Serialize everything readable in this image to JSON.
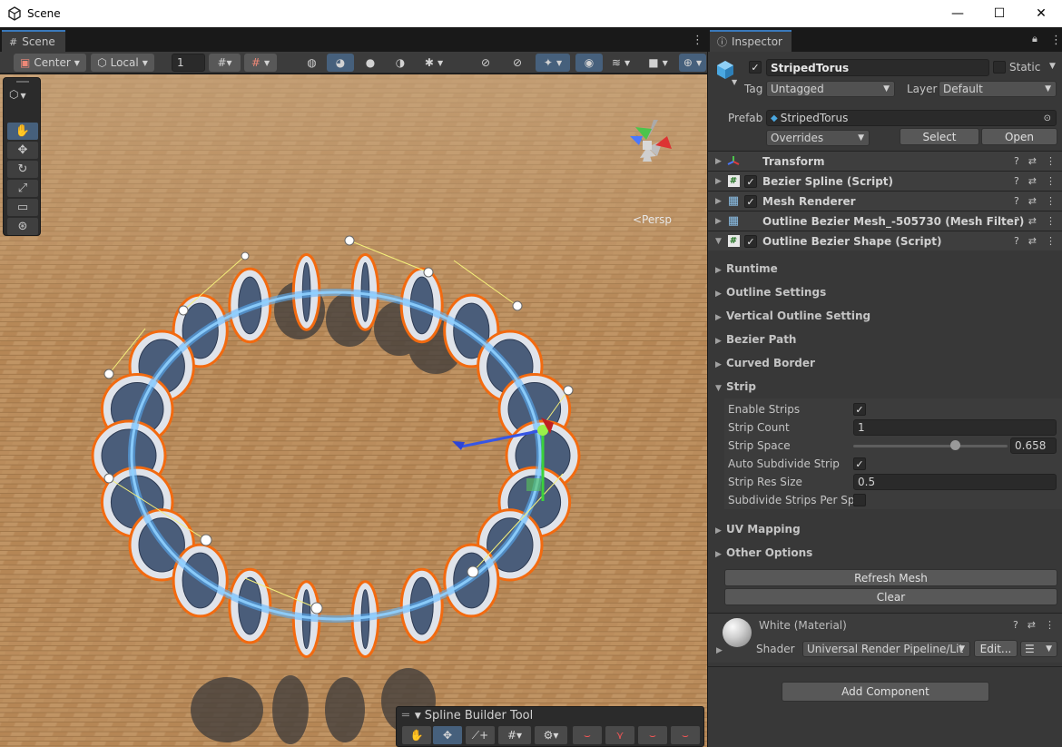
{
  "window": {
    "title": "Scene",
    "minimize": "—",
    "maximize": "☐",
    "close": "✕"
  },
  "scene_tab": {
    "label": "Scene"
  },
  "scene_toolbar": {
    "pivot_label": "Center",
    "space_label": "Local",
    "grid_value": "1"
  },
  "viewport": {
    "persp_label": "<Persp"
  },
  "spline_tool": {
    "title": "Spline Builder Tool"
  },
  "inspector_tab": {
    "label": "Inspector"
  },
  "object": {
    "name": "StripedTorus",
    "static_label": "Static",
    "tag_label": "Tag",
    "tag_value": "Untagged",
    "layer_label": "Layer",
    "layer_value": "Default",
    "prefab_label": "Prefab",
    "prefab_value": "StripedTorus",
    "overrides_value": "Overrides",
    "select_button": "Select",
    "open_button": "Open"
  },
  "components": [
    {
      "name": "Transform",
      "icon": "transform-icon",
      "has_check": false
    },
    {
      "name": "Bezier Spline (Script)",
      "icon": "script-icon",
      "has_check": true
    },
    {
      "name": "Mesh Renderer",
      "icon": "mesh-renderer-icon",
      "has_check": true
    },
    {
      "name": "Outline Bezier Mesh_-505730 (Mesh Filter)",
      "icon": "mesh-filter-icon",
      "has_check": false
    },
    {
      "name": "Outline Bezier Shape (Script)",
      "icon": "script-icon",
      "has_check": true
    }
  ],
  "sections": {
    "runtime": "Runtime",
    "outline_settings": "Outline Settings",
    "vertical_outline": "Vertical Outline Setting",
    "bezier_path": "Bezier Path",
    "curved_border": "Curved Border",
    "strip": "Strip",
    "uv_mapping": "UV Mapping",
    "other_options": "Other Options"
  },
  "strip": {
    "enable_strips_label": "Enable Strips",
    "enable_strips_checked": true,
    "strip_count_label": "Strip Count",
    "strip_count_value": "1",
    "strip_space_label": "Strip Space",
    "strip_space_value": "0.658",
    "auto_subdivide_label": "Auto Subdivide Strip",
    "auto_subdivide_checked": true,
    "strip_res_label": "Strip Res Size",
    "strip_res_value": "0.5",
    "subdivide_per_spline_label": "Subdivide Strips Per Spl",
    "subdivide_per_spline_checked": false
  },
  "buttons": {
    "refresh_mesh": "Refresh Mesh",
    "clear": "Clear",
    "add_component": "Add Component"
  },
  "material": {
    "name": "White (Material)",
    "shader_label": "Shader",
    "shader_value": "Universal Render Pipeline/Lit",
    "edit_button": "Edit..."
  },
  "colors": {
    "accent": "#46607c",
    "tab_highlight": "#3a79bb",
    "outline": "#f26a10",
    "ground": "#b98c5e"
  }
}
